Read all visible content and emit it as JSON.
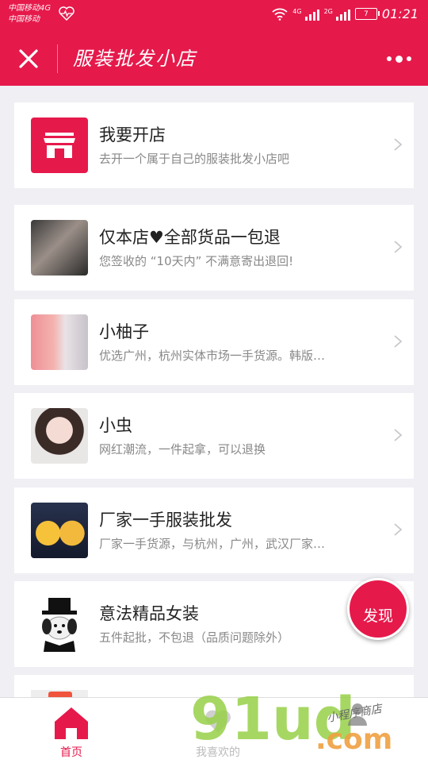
{
  "status_bar": {
    "carrier_1": "中国移动4G",
    "carrier_2": "中国移动",
    "net_1": "4G",
    "net_2": "2G",
    "battery": "7",
    "time": "01:21"
  },
  "titlebar": {
    "title": "服装批发小店"
  },
  "stores": [
    {
      "title": "我要开店",
      "subtitle": "去开一个属于自己的服装批发小店吧"
    },
    {
      "title": "仅本店♥全部货品一包退",
      "subtitle": "您签收的 “10天内” 不满意寄出退回!"
    },
    {
      "title": "小柚子",
      "subtitle": "优选广州，杭州实体市场一手货源。韩版…"
    },
    {
      "title": "小虫",
      "subtitle": "网红潮流，一件起拿，可以退换"
    },
    {
      "title": "厂家一手服装批发",
      "subtitle": "厂家一手货源，与杭州，广州，武汉厂家…"
    },
    {
      "title": "意法精品女装",
      "subtitle": "五件起批，不包退（品质问题除外）"
    }
  ],
  "discover_button": "发现",
  "tabs": {
    "home": "首页",
    "mine": "我喜欢的"
  },
  "watermark": {
    "big": "91ud",
    "dot_com": ".com",
    "small": "小程序商店"
  },
  "colors": {
    "brand": "#e6194b",
    "background": "#efeff4"
  }
}
